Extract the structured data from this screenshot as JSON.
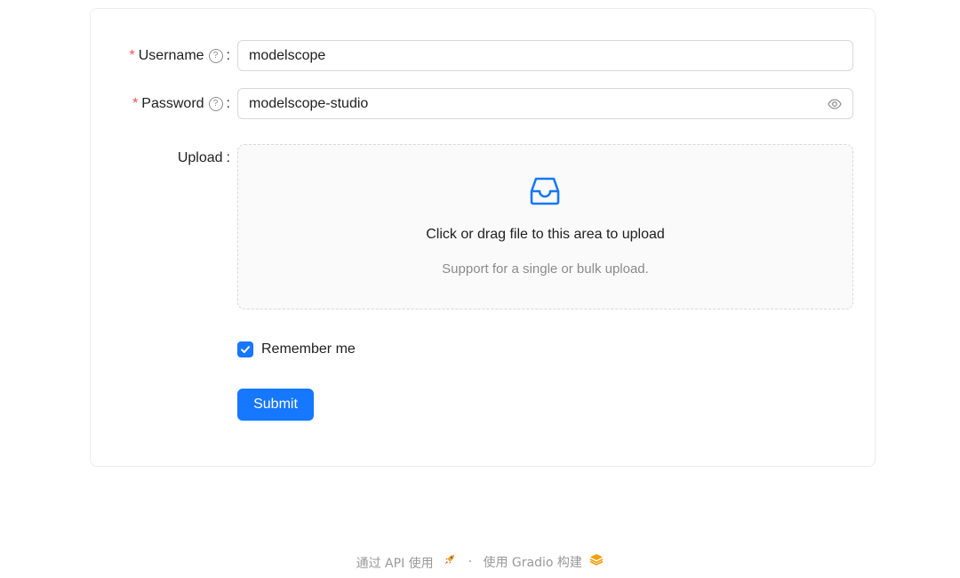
{
  "form": {
    "username": {
      "label": "Username",
      "required_mark": "*",
      "help_icon": "question-circle-icon",
      "value": "modelscope"
    },
    "password": {
      "label": "Password",
      "required_mark": "*",
      "help_icon": "question-circle-icon",
      "value": "modelscope-studio",
      "toggle_icon": "eye-icon"
    },
    "upload": {
      "label": "Upload",
      "icon": "inbox-icon",
      "text": "Click or drag file to this area to upload",
      "hint": "Support for a single or bulk upload."
    },
    "remember": {
      "label": "Remember me",
      "checked": true
    },
    "submit_label": "Submit",
    "colon": ":"
  },
  "footer": {
    "api_text": "通过 API 使用",
    "api_icon": "rocket-icon",
    "separator": "·",
    "built_text": "使用 Gradio 构建",
    "gradio_icon": "gradio-logo-icon"
  },
  "colors": {
    "primary": "#1677ff",
    "required": "#ff4d4f"
  }
}
